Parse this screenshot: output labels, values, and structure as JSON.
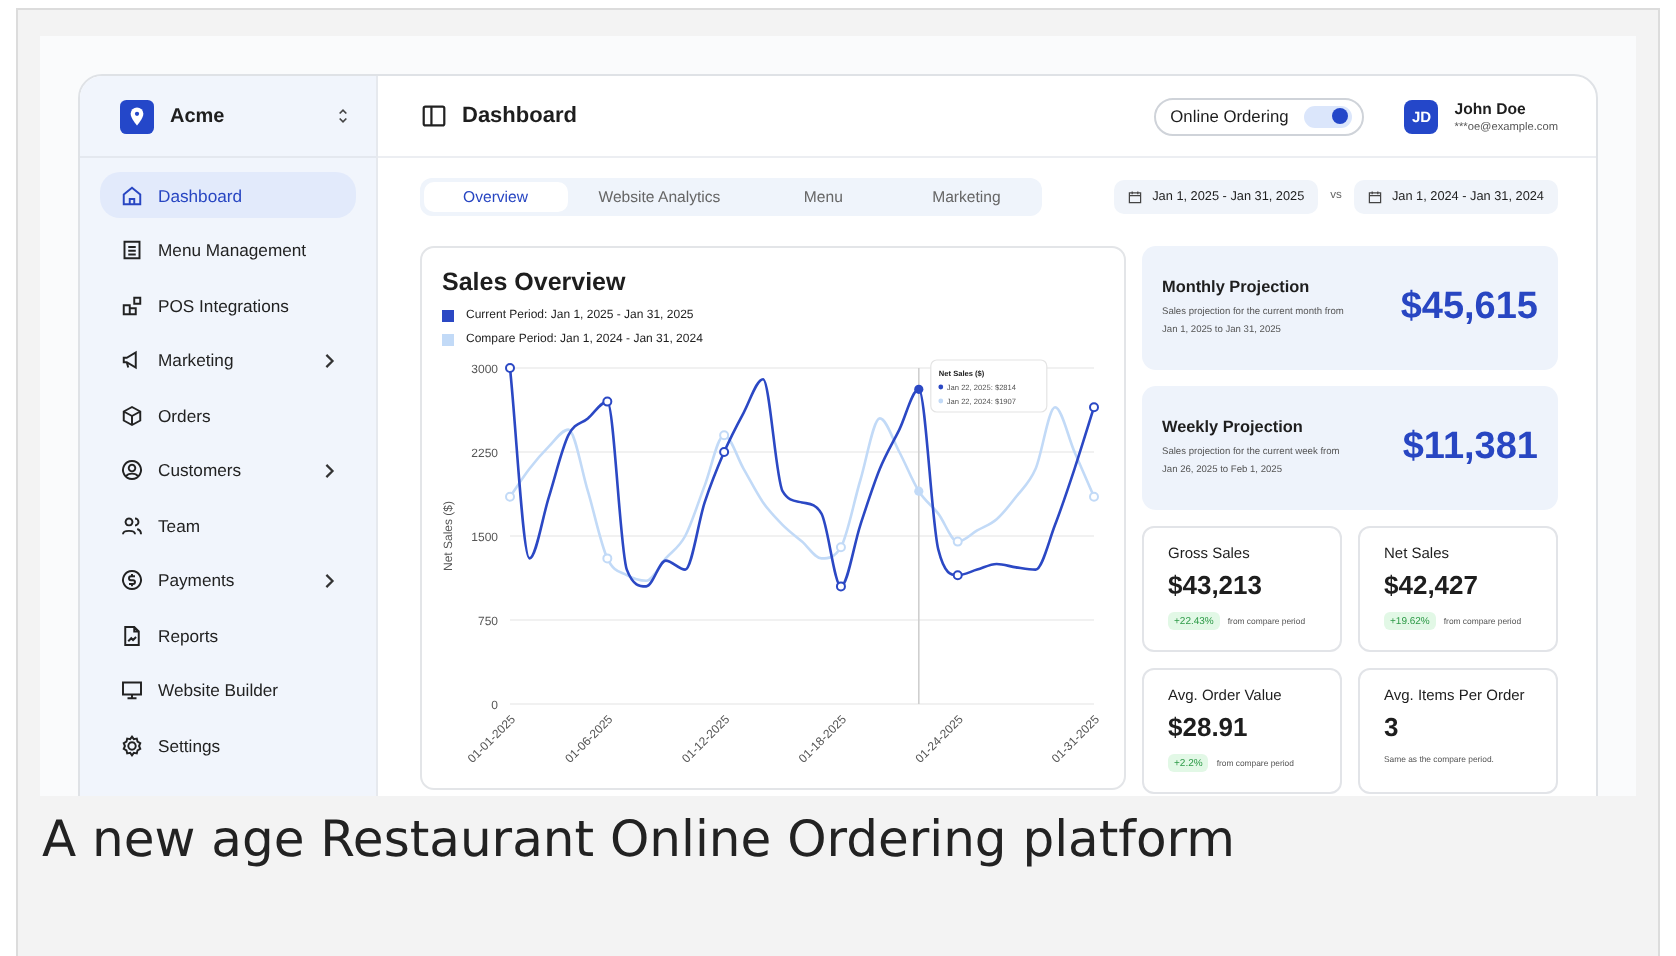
{
  "sidebar": {
    "brand": "Acme",
    "items": [
      {
        "label": "Dashboard",
        "selected": true,
        "has_submenu": false
      },
      {
        "label": "Menu Management",
        "selected": false,
        "has_submenu": false
      },
      {
        "label": "POS Integrations",
        "selected": false,
        "has_submenu": false
      },
      {
        "label": "Marketing",
        "selected": false,
        "has_submenu": true
      },
      {
        "label": "Orders",
        "selected": false,
        "has_submenu": false
      },
      {
        "label": "Customers",
        "selected": false,
        "has_submenu": true
      },
      {
        "label": "Team",
        "selected": false,
        "has_submenu": false
      },
      {
        "label": "Payments",
        "selected": false,
        "has_submenu": true
      },
      {
        "label": "Reports",
        "selected": false,
        "has_submenu": false
      },
      {
        "label": "Website Builder",
        "selected": false,
        "has_submenu": false
      },
      {
        "label": "Settings",
        "selected": false,
        "has_submenu": false
      }
    ]
  },
  "header": {
    "title": "Dashboard",
    "toggle": {
      "label": "Online Ordering",
      "on": true
    },
    "user": {
      "initials": "JD",
      "name": "John Doe",
      "email": "***oe@example.com"
    }
  },
  "tabs": [
    {
      "label": "Overview",
      "selected": true
    },
    {
      "label": "Website Analytics",
      "selected": false
    },
    {
      "label": "Menu",
      "selected": false
    },
    {
      "label": "Marketing",
      "selected": false
    }
  ],
  "date_ranges": {
    "current": "Jan 1, 2025 - Jan 31, 2025",
    "separator": "vs",
    "compare": "Jan 1, 2024 - Jan 31, 2024"
  },
  "sales_chart": {
    "title": "Sales Overview",
    "chart_data": {
      "type": "line",
      "ylabel": "Net Sales ($)",
      "categories": [
        "01-01-2025",
        null,
        null,
        null,
        null,
        "01-06-2025",
        null,
        null,
        null,
        null,
        null,
        "01-12-2025",
        null,
        null,
        null,
        null,
        null,
        "01-18-2025",
        null,
        null,
        null,
        null,
        null,
        "01-24-2025",
        null,
        null,
        null,
        null,
        null,
        null,
        "01-31-2025"
      ],
      "series": [
        {
          "name": "Current Period: Jan 1, 2025 - Jan 31, 2025",
          "color": "#2b48c4",
          "values": [
            3000,
            1300,
            1850,
            2400,
            2550,
            2700,
            1200,
            1050,
            1280,
            1200,
            1800,
            2250,
            2600,
            2900,
            1900,
            1800,
            1700,
            1050,
            1600,
            2100,
            2450,
            2810,
            1380,
            1150,
            1200,
            1250,
            1220,
            1200,
            1600,
            2100,
            2650
          ]
        },
        {
          "name": "Compare Period: Jan 1, 2024 - Jan 31, 2024",
          "color": "#c2daf7",
          "values": [
            1850,
            2100,
            2300,
            2450,
            1900,
            1300,
            1150,
            1100,
            1300,
            1500,
            1950,
            2400,
            2100,
            1800,
            1600,
            1450,
            1300,
            1400,
            2000,
            2550,
            2250,
            1900,
            1700,
            1450,
            1550,
            1650,
            1850,
            2100,
            2650,
            2250,
            1850
          ]
        }
      ],
      "ylim": [
        0,
        3000
      ],
      "yticks": [
        0,
        750,
        1500,
        2250,
        3000
      ],
      "grid": true
    },
    "tooltip": {
      "title": "Net Sales ($)",
      "lines": [
        "Jan 22, 2025: $2814",
        "Jan 22, 2024: $1907"
      ]
    }
  },
  "projections": [
    {
      "title": "Monthly Projection",
      "description": "Sales projection for the current month from Jan 1, 2025 to Jan 31, 2025",
      "value": "$45,615"
    },
    {
      "title": "Weekly Projection",
      "description": "Sales projection for the current week from Jan 26, 2025 to Feb 1, 2025",
      "value": "$11,381"
    }
  ],
  "stats": [
    {
      "title": "Gross Sales",
      "value": "$43,213",
      "change": "+22.43%",
      "note": "from compare period"
    },
    {
      "title": "Net Sales",
      "value": "$42,427",
      "change": "+19.62%",
      "note": "from compare period"
    },
    {
      "title": "Avg. Order Value",
      "value": "$28.91",
      "change": "+2.2%",
      "note": "from compare period"
    },
    {
      "title": "Avg. Items Per Order",
      "value": "3",
      "note": "Same as the compare period."
    }
  ],
  "caption": "A new age Restaurant Online Ordering platform"
}
